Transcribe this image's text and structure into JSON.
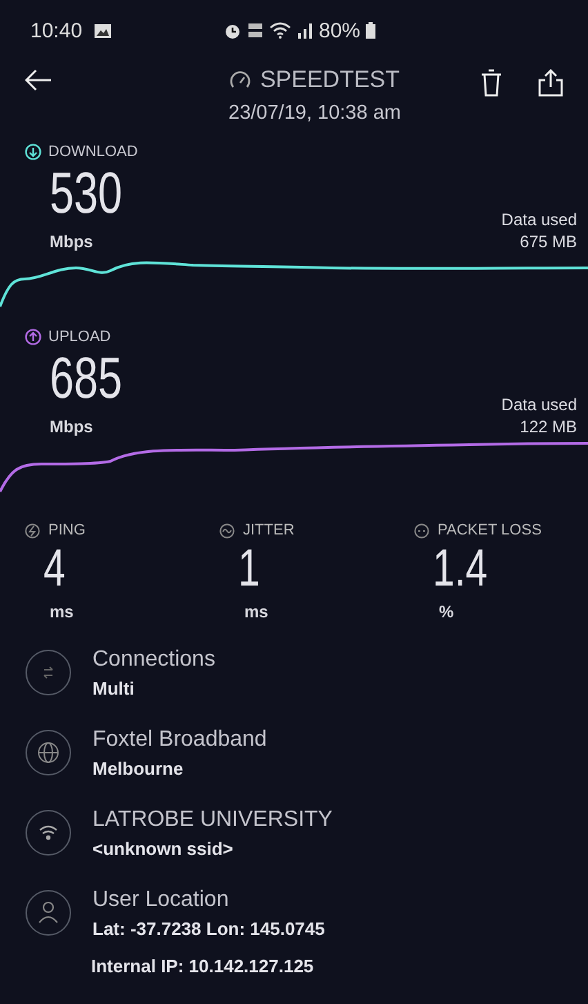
{
  "status_bar": {
    "time": "10:40",
    "battery": "80%"
  },
  "header": {
    "title": "SPEEDTEST",
    "date": "23/07/19, 10:38 am"
  },
  "tests": [
    {
      "kind": "download",
      "label": "DOWNLOAD",
      "value": "530",
      "unit": "Mbps",
      "data_label": "Data used",
      "data_value": "675 MB",
      "color": "#5fe3d8"
    },
    {
      "kind": "upload",
      "label": "UPLOAD",
      "value": "685",
      "unit": "Mbps",
      "data_label": "Data used",
      "data_value": "122 MB",
      "color": "#b36be6"
    }
  ],
  "stats": [
    {
      "kind": "ping",
      "label": "PING",
      "value": "4",
      "unit": "ms"
    },
    {
      "kind": "jitter",
      "label": "JITTER",
      "value": "1",
      "unit": "ms"
    },
    {
      "kind": "loss",
      "label": "PACKET LOSS",
      "value": "1.4",
      "unit": "%"
    }
  ],
  "info": [
    {
      "kind": "connections",
      "title": "Connections",
      "detail": "Multi"
    },
    {
      "kind": "provider",
      "title": "Foxtel Broadband",
      "detail": "Melbourne"
    },
    {
      "kind": "wifi",
      "title": "LATROBE UNIVERSITY",
      "detail": "<unknown ssid>"
    },
    {
      "kind": "location",
      "title": "User Location",
      "detail": "Lat: -37.7238 Lon: 145.0745"
    }
  ],
  "internal_ip": "Internal IP: 10.142.127.125"
}
